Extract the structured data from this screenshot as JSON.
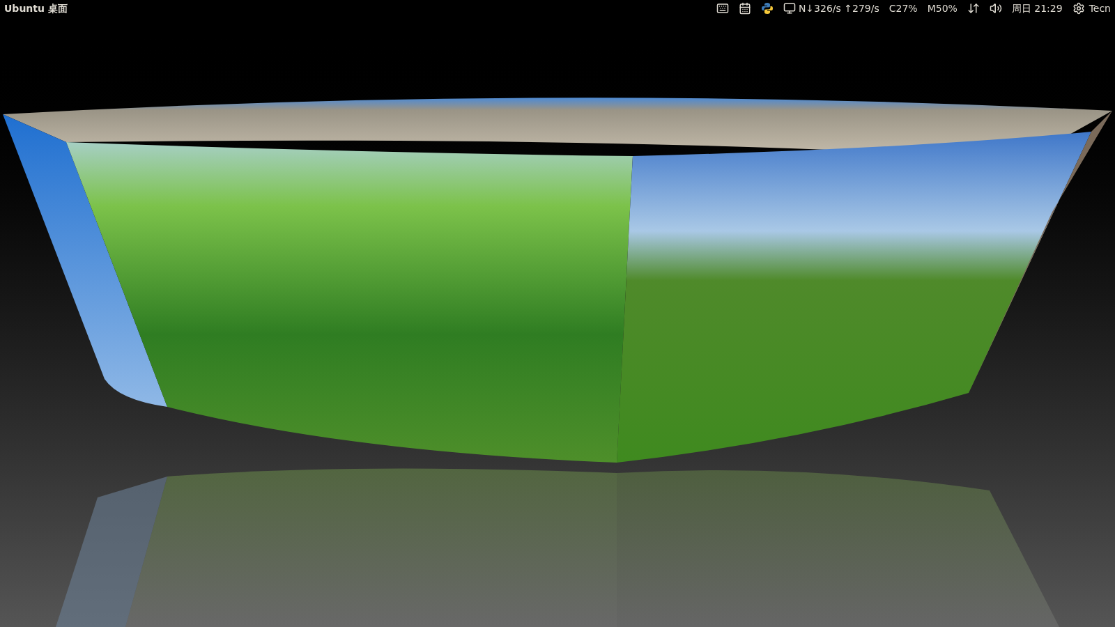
{
  "top_bar": {
    "title": "Ubuntu 桌面",
    "net_speed": "N↓326/s ↑279/s",
    "cpu": "C27%",
    "memory": "M50%",
    "clock": "周日 21:29",
    "user": "Tecn"
  }
}
